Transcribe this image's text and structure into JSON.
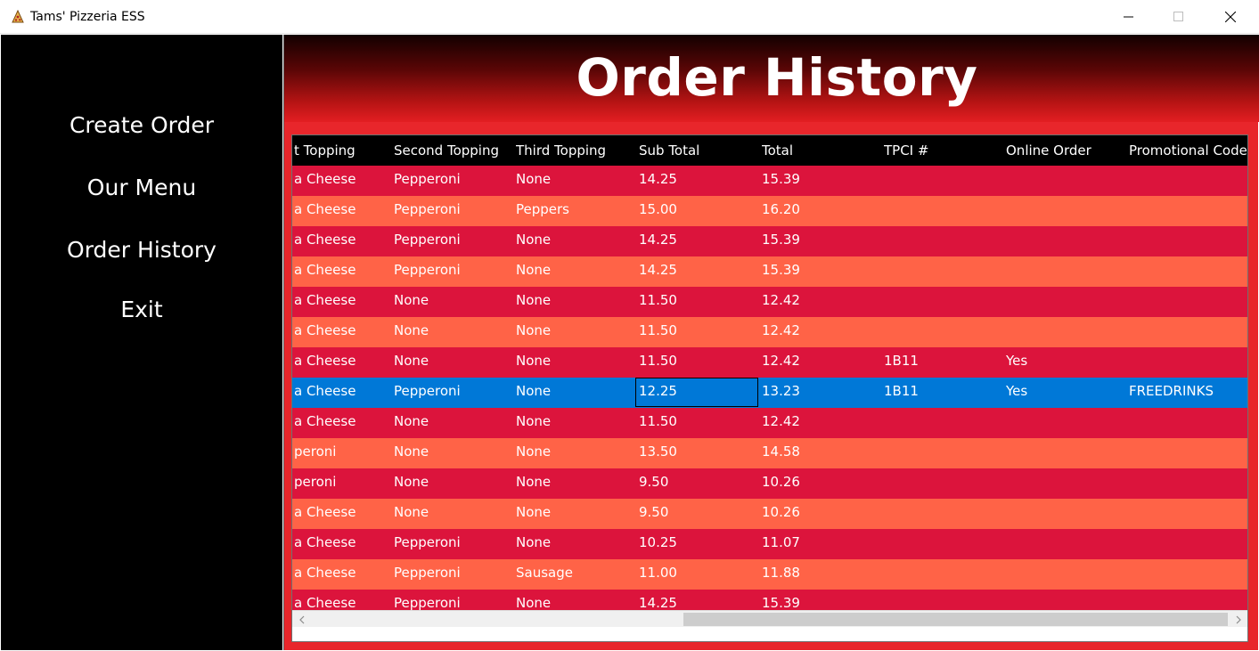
{
  "window": {
    "title": "Tams' Pizzeria ESS",
    "icon": "pizza-app-icon",
    "controls": [
      "minimize-icon",
      "maximize-icon",
      "close-icon"
    ]
  },
  "sidebar": {
    "items": [
      {
        "label": "Create Order"
      },
      {
        "label": "Our Menu"
      },
      {
        "label": "Order History"
      },
      {
        "label": "Exit"
      }
    ]
  },
  "main": {
    "title": "Order History"
  },
  "colors": {
    "sidebar_bg": "#000000",
    "main_bg": "#e8262b",
    "row_odd": "#dc143c",
    "row_even": "#ff6347",
    "row_selected": "#0078d7",
    "header_bg": "#000000"
  },
  "grid": {
    "columns": [
      "t Topping",
      "Second Topping",
      "Third Topping",
      "Sub Total",
      "Total",
      "TPCI #",
      "Online Order",
      "Promotional Code"
    ],
    "selected_row": 7,
    "rows": [
      [
        "a Cheese",
        "Pepperoni",
        "None",
        "14.25",
        "15.39",
        "",
        "",
        ""
      ],
      [
        "a Cheese",
        "Pepperoni",
        "Peppers",
        "15.00",
        "16.20",
        "",
        "",
        ""
      ],
      [
        "a Cheese",
        "Pepperoni",
        "None",
        "14.25",
        "15.39",
        "",
        "",
        ""
      ],
      [
        "a Cheese",
        "Pepperoni",
        "None",
        "14.25",
        "15.39",
        "",
        "",
        ""
      ],
      [
        "a Cheese",
        "None",
        "None",
        "11.50",
        "12.42",
        "",
        "",
        ""
      ],
      [
        "a Cheese",
        "None",
        "None",
        "11.50",
        "12.42",
        "",
        "",
        ""
      ],
      [
        "a Cheese",
        "None",
        "None",
        "11.50",
        "12.42",
        "1B11",
        "Yes",
        ""
      ],
      [
        "a Cheese",
        "Pepperoni",
        "None",
        "12.25",
        "13.23",
        "1B11",
        "Yes",
        "FREEDRINKS"
      ],
      [
        "a Cheese",
        "None",
        "None",
        "11.50",
        "12.42",
        "",
        "",
        ""
      ],
      [
        "peroni",
        "None",
        "None",
        "13.50",
        "14.58",
        "",
        "",
        ""
      ],
      [
        "peroni",
        "None",
        "None",
        "9.50",
        "10.26",
        "",
        "",
        ""
      ],
      [
        "a Cheese",
        "None",
        "None",
        "9.50",
        "10.26",
        "",
        "",
        ""
      ],
      [
        "a Cheese",
        "Pepperoni",
        "None",
        "10.25",
        "11.07",
        "",
        "",
        ""
      ],
      [
        "a Cheese",
        "Pepperoni",
        "Sausage",
        "11.00",
        "11.88",
        "",
        "",
        ""
      ],
      [
        "a Cheese",
        "Pepperoni",
        "None",
        "14.25",
        "15.39",
        "",
        "",
        ""
      ]
    ],
    "scroll": {
      "left_arrow": "chevron-left-icon",
      "right_arrow": "chevron-right-icon"
    }
  }
}
